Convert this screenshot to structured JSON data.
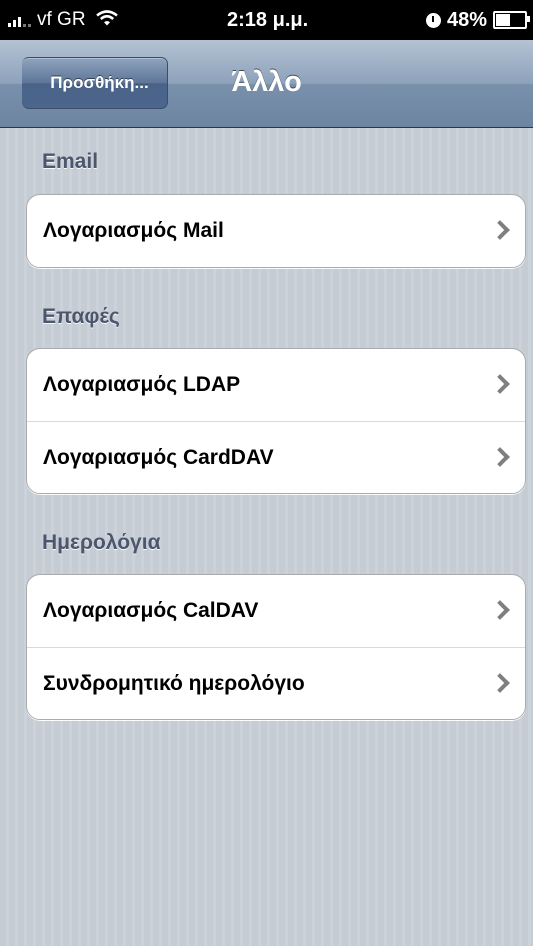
{
  "status_bar": {
    "carrier": "vf GR",
    "time": "2:18 μ.μ.",
    "battery_text": "48%",
    "battery_level": 0.48
  },
  "nav": {
    "back_label": "Προσθήκη...",
    "title": "Άλλο"
  },
  "sections": [
    {
      "header": "Email",
      "rows": [
        {
          "label": "Λογαριασμός Mail"
        }
      ]
    },
    {
      "header": "Επαφές",
      "rows": [
        {
          "label": "Λογαριασμός LDAP"
        },
        {
          "label": "Λογαριασμός CardDAV"
        }
      ]
    },
    {
      "header": "Ημερολόγια",
      "rows": [
        {
          "label": "Λογαριασμός CalDAV"
        },
        {
          "label": "Συνδρομητικό ημερολόγιο"
        }
      ]
    }
  ],
  "icons": {
    "signal": "signal-bars-icon",
    "wifi": "wifi-icon",
    "alarm": "alarm-clock-icon",
    "battery": "battery-icon",
    "disclosure": "chevron-right-icon"
  },
  "colors": {
    "background": "#c5ccd4",
    "navbar": "#6d85a2",
    "section_header": "#4c566c"
  }
}
